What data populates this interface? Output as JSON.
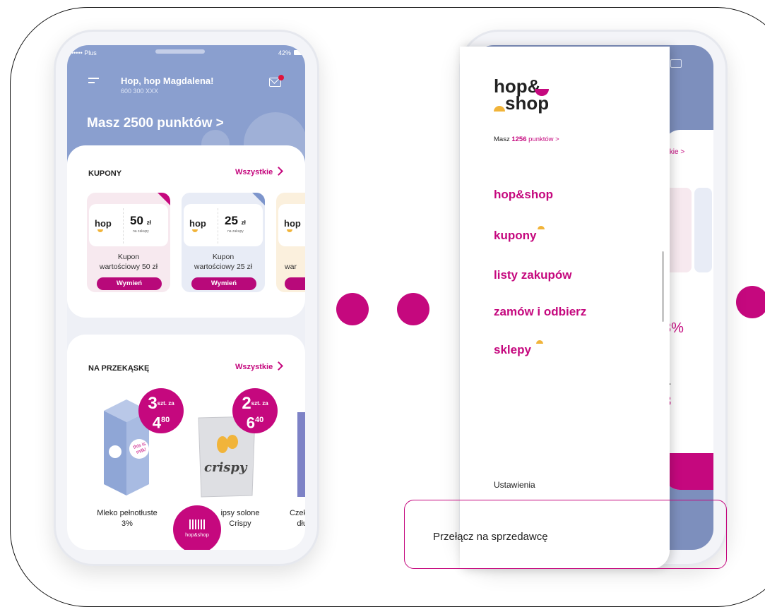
{
  "left_screen": {
    "status": {
      "carrier": "••••• Plus",
      "battery": "42%"
    },
    "header": {
      "greeting": "Hop, hop Magdalena!",
      "phone": "600 300 XXX",
      "points": "Masz 2500 punktów >"
    },
    "coupons": {
      "title": "KUPONY",
      "all_link": "Wszystkie",
      "items": [
        {
          "logo": "hop",
          "value": "50",
          "unit": "zł",
          "sub": "na zakupy",
          "desc1": "Kupon",
          "desc2": "wartościowy 50 zł",
          "button": "Wymień",
          "bg": "#f7e9ef",
          "accent": "#c5087e"
        },
        {
          "logo": "hop",
          "value": "25",
          "unit": "zł",
          "sub": "na zakupy",
          "desc1": "Kupon",
          "desc2": "wartościowy 25 zł",
          "button": "Wymień",
          "bg": "#e8ecf6",
          "accent": "#7d95cc"
        },
        {
          "logo": "hop",
          "value": "",
          "unit": "",
          "sub": "",
          "desc1": "",
          "desc2": "war",
          "button": "",
          "bg": "#fbf0dd",
          "accent": "#f1b43a"
        }
      ]
    },
    "snacks": {
      "title": "NA PRZEKĄSKĘ",
      "all_link": "Wszystkie",
      "items": [
        {
          "name1": "Mleko pełnotłuste",
          "name2": "3%",
          "badge_qty": "3",
          "badge_label": "szt. za",
          "badge_price": "4",
          "badge_cents": "80",
          "pack_text": "this is milk!"
        },
        {
          "name1": "ipsy solone",
          "name2": "Crispy",
          "badge_qty": "2",
          "badge_label": "szt. za",
          "badge_price": "6",
          "badge_cents": "40",
          "pack_text": "crispy"
        },
        {
          "name1": "Czek",
          "name2": "dłu"
        }
      ]
    },
    "fab_label": "hop&shop"
  },
  "menu": {
    "brand_line1": "hop&",
    "brand_line2": "shop",
    "points_prefix": "Masz",
    "points_value": "1256",
    "points_suffix": "punktów >",
    "items": [
      "hop&shop",
      "kupony",
      "listy zakupów",
      "zamów i odbierz",
      "sklepy"
    ],
    "settings": "Ustawienia",
    "switch": "Przełącz na sprzedawcę"
  },
  "right_background": {
    "link_peek": "tkie >",
    "percent_peek": "3%",
    "a_peek": "a",
    "num_peek": "3",
    "zl_peek": "ł"
  },
  "colors": {
    "brand": "#c5087e",
    "header_blue": "#8a9fcf",
    "yellow": "#f1b43a"
  }
}
